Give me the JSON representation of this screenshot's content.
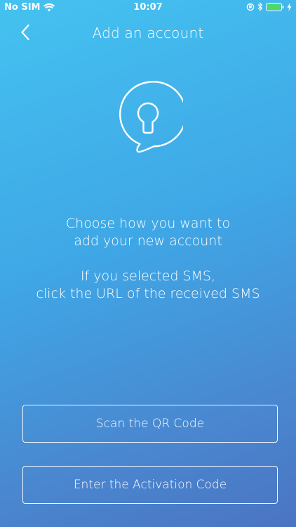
{
  "status_bar": {
    "carrier": "No SIM",
    "time": "10:07",
    "icons": [
      "wifi-icon",
      "orientation-lock-icon",
      "bluetooth-icon",
      "battery-icon",
      "charging-icon"
    ],
    "battery_level": 1.0,
    "battery_color": "#4cd964"
  },
  "header": {
    "title": "Add an account",
    "back_icon": "chevron-left-icon"
  },
  "illustration": {
    "icon": "keyhole-icon"
  },
  "instructions": {
    "line1": "Choose how you want to",
    "line2": "add your new account",
    "line3": "If you selected SMS,",
    "line4": "click the URL of the received SMS"
  },
  "buttons": {
    "scan_qr": "Scan the QR Code",
    "activation_code": "Enter the Activation Code"
  },
  "colors": {
    "gradient_top": "#44c2f0",
    "gradient_bottom": "#4b74c2",
    "text": "#ffffff"
  }
}
